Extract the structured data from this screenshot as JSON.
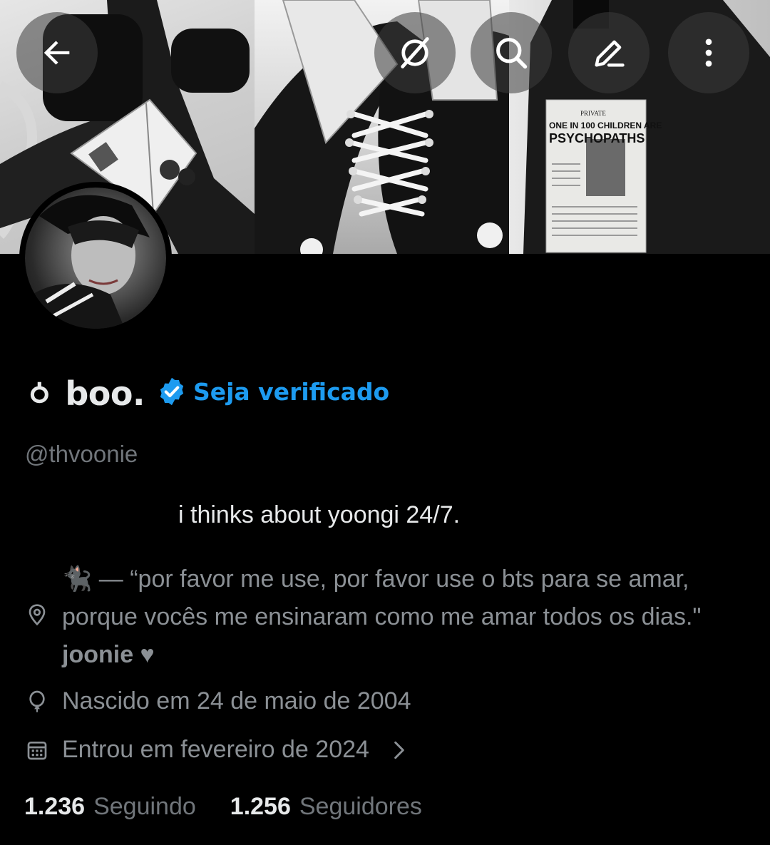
{
  "header": {
    "back_icon": "arrow-left-icon",
    "grok_icon": "grok-icon",
    "search_icon": "search-icon",
    "edit_icon": "pencil-icon",
    "more_icon": "more-vertical-icon"
  },
  "banner": {
    "newspaper_private": "PRIVATE",
    "newspaper_headline_1": "ONE IN 100 CHILDREN ARE",
    "newspaper_headline_2": "PSYCHOPATHS"
  },
  "profile": {
    "display_name": "ㆁ boo.",
    "get_verified": "Seja verificado",
    "handle": "@thvoonie",
    "bio_line": "i thinks about yoongi 24/7.",
    "location_emoji": "🐈‍⬛",
    "location_text": " — “por favor me use, por favor use o bts para se amar, porque vocês me ensinaram como me amar todos os dias.\" ",
    "location_strong": "joonie",
    "location_heart": " ♥",
    "birth": "Nascido em 24 de maio de 2004",
    "joined": "Entrou em fevereiro de 2024",
    "following_count": "1.236",
    "following_label": "Seguindo",
    "followers_count": "1.256",
    "followers_label": "Seguidores"
  },
  "colors": {
    "background": "#000000",
    "primary_text": "#e7e9ea",
    "secondary_text": "#71767b",
    "accent": "#1d9bf0"
  }
}
